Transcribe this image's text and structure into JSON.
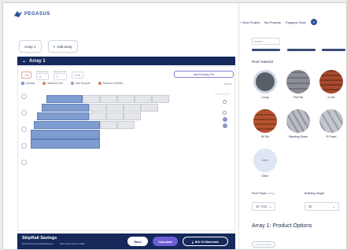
{
  "app": {
    "logo_text": "PEGASUS"
  },
  "tabs": [
    {
      "label": "Array 1"
    },
    {
      "label": "Add array"
    }
  ],
  "array_header": {
    "title": "Array 1"
  },
  "controls": {
    "module_value": "1 B",
    "m2_label": "Module Qty",
    "m2_value": "0",
    "m3_label": "Module Pitch",
    "m3_value": "0",
    "m4_value": "0.00",
    "outline_button": "Add Existing Tile"
  },
  "legend": [
    {
      "label": "Module",
      "color": "#7f9cd0"
    },
    {
      "label": "Blocked Cell",
      "color": "#e08a7a"
    },
    {
      "label": "Add Module",
      "color": "#9aa9c9"
    },
    {
      "label": "Remove (500W)",
      "color": "#d98c6d"
    }
  ],
  "reset_label": "Reset",
  "bottom": {
    "title": "SkipRail Savings",
    "sub1": "10% Fewer Roof Attachments",
    "sub2": "41% Fewer Feet of Rail",
    "save": "Save",
    "calculate": "Calculate",
    "bom": "Bill Of Materials"
  },
  "nav": {
    "new_project": "New Project",
    "my_projects": "My Projects",
    "user": "Pegasus Solar",
    "avatar_initial": "P"
  },
  "right": {
    "search_placeholder": "Search",
    "roof_material_label": "Roof material",
    "roof_types": [
      {
        "label": "Comp",
        "color": "#5a6067"
      },
      {
        "label": "Flat Tile",
        "color": "#8b8e94"
      },
      {
        "label": "S-Tile",
        "color": "#a84a2e"
      },
      {
        "label": "W-Tile",
        "color": "#b5532f"
      },
      {
        "label": "Standing Seam",
        "color": "#b9bcc2"
      },
      {
        "label": "R-Panel",
        "color": "#c2c5cb"
      },
      {
        "label": "Other",
        "color": "#dfe5f5"
      }
    ],
    "roof_slope_label": "Roof Slope",
    "roof_slope_unit": "(deg)",
    "roof_slope_value": "10",
    "roof_slope_value2": "2/12",
    "building_height_label": "Building height",
    "building_height_value": "30",
    "product_options_title": "Array 1: Product Options",
    "toggle_label": "Advanced Spec"
  }
}
